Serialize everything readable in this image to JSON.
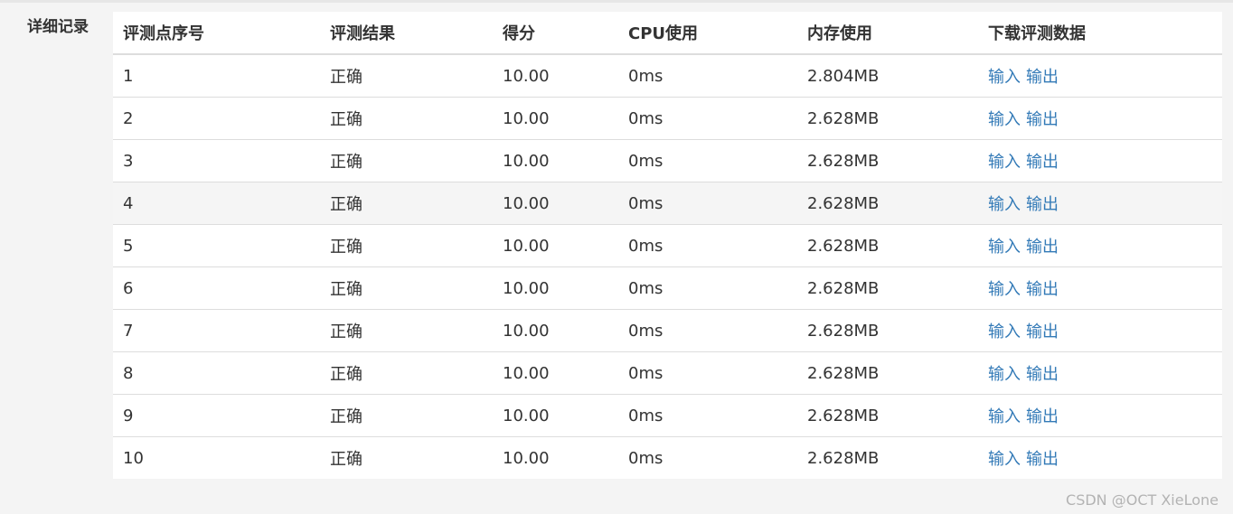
{
  "section_label": "详细记录",
  "columns": [
    "评测点序号",
    "评测结果",
    "得分",
    "CPU使用",
    "内存使用",
    "下载评测数据"
  ],
  "link_labels": {
    "input": "输入",
    "output": "输出"
  },
  "rows": [
    {
      "index": "1",
      "result": "正确",
      "score": "10.00",
      "cpu": "0ms",
      "memory": "2.804MB"
    },
    {
      "index": "2",
      "result": "正确",
      "score": "10.00",
      "cpu": "0ms",
      "memory": "2.628MB"
    },
    {
      "index": "3",
      "result": "正确",
      "score": "10.00",
      "cpu": "0ms",
      "memory": "2.628MB"
    },
    {
      "index": "4",
      "result": "正确",
      "score": "10.00",
      "cpu": "0ms",
      "memory": "2.628MB"
    },
    {
      "index": "5",
      "result": "正确",
      "score": "10.00",
      "cpu": "0ms",
      "memory": "2.628MB"
    },
    {
      "index": "6",
      "result": "正确",
      "score": "10.00",
      "cpu": "0ms",
      "memory": "2.628MB"
    },
    {
      "index": "7",
      "result": "正确",
      "score": "10.00",
      "cpu": "0ms",
      "memory": "2.628MB"
    },
    {
      "index": "8",
      "result": "正确",
      "score": "10.00",
      "cpu": "0ms",
      "memory": "2.628MB"
    },
    {
      "index": "9",
      "result": "正确",
      "score": "10.00",
      "cpu": "0ms",
      "memory": "2.628MB"
    },
    {
      "index": "10",
      "result": "正确",
      "score": "10.00",
      "cpu": "0ms",
      "memory": "2.628MB"
    }
  ],
  "hovered_row": 3,
  "watermark": "CSDN @OCT XieLone",
  "colors": {
    "link": "#337ab7",
    "text": "#333333",
    "border": "#dddddd",
    "hover_row": "#f5f5f5",
    "page_bg": "#f4f4f4"
  }
}
